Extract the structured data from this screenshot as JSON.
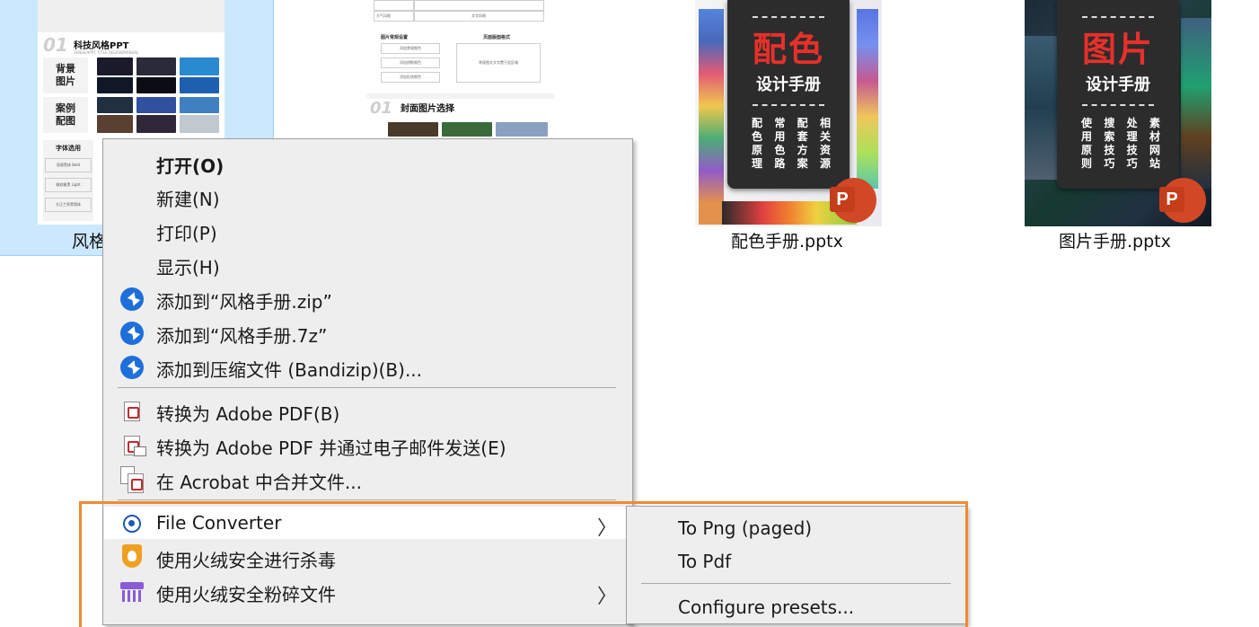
{
  "files": {
    "fengge": {
      "name": "风格手册.pptx",
      "visible_name": "风格",
      "thumb": {
        "num": "01",
        "title": "科技风格PPT",
        "subtitle": "SENSE/APPT. TITLE DESIGN/MANUAL",
        "label_bg": "背景\n图片",
        "label_case": "案例\n配图",
        "label_font": "字体选用",
        "font_boxes": [
          "思源黑体 Bold",
          "微软雅黑 Light",
          "方正兰亭黑简体"
        ]
      }
    },
    "wangge": {
      "thumb": {
        "rows": [
          "大气风格",
          "文字风格"
        ],
        "section_left": "图片常规设置",
        "section_right": "页面版面格式",
        "small_boxes": [
          "添加常规颜色",
          "添加阴影颜色",
          "添加形状颜色"
        ],
        "placeholder": "常规图文文字置于此区域",
        "num": "01",
        "title2": "封面图片选择"
      }
    },
    "peise": {
      "name": "配色手册.pptx",
      "big": "配色",
      "mid": "设计手册",
      "cols": [
        "配色原理",
        "常用色路",
        "配套方案",
        "相关资源"
      ],
      "badge": "P"
    },
    "tupian": {
      "name": "图片手册.pptx",
      "big": "图片",
      "mid": "设计手册",
      "cols": [
        "使用原则",
        "搜索技巧",
        "处理技巧",
        "素材网站"
      ],
      "badge": "P"
    }
  },
  "context_menu": {
    "open": "打开(O)",
    "new": "新建(N)",
    "print": "打印(P)",
    "show": "显示(H)",
    "add_zip": "添加到“风格手册.zip”",
    "add_7z": "添加到“风格手册.7z”",
    "add_compress": "添加到压缩文件 (Bandizip)(B)...",
    "to_pdf": "转换为 Adobe PDF(B)",
    "to_pdf_mail": "转换为 Adobe PDF 并通过电子邮件发送(E)",
    "acrobat_merge": "在 Acrobat 中合并文件...",
    "file_converter": "File Converter",
    "antivirus": "使用火绒安全进行杀毒",
    "shred": "使用火绒安全粉碎文件",
    "arrow": "〉"
  },
  "submenu": {
    "to_png": "To Png (paged)",
    "to_pdf": "To Pdf",
    "configure": "Configure presets..."
  },
  "colors": {
    "selection_bg": "#cce8ff",
    "menu_bg": "#eeeeee",
    "highlight_border": "#f08a30",
    "bandizip_blue": "#1e6fd9",
    "ppt_orange": "#d24726"
  }
}
